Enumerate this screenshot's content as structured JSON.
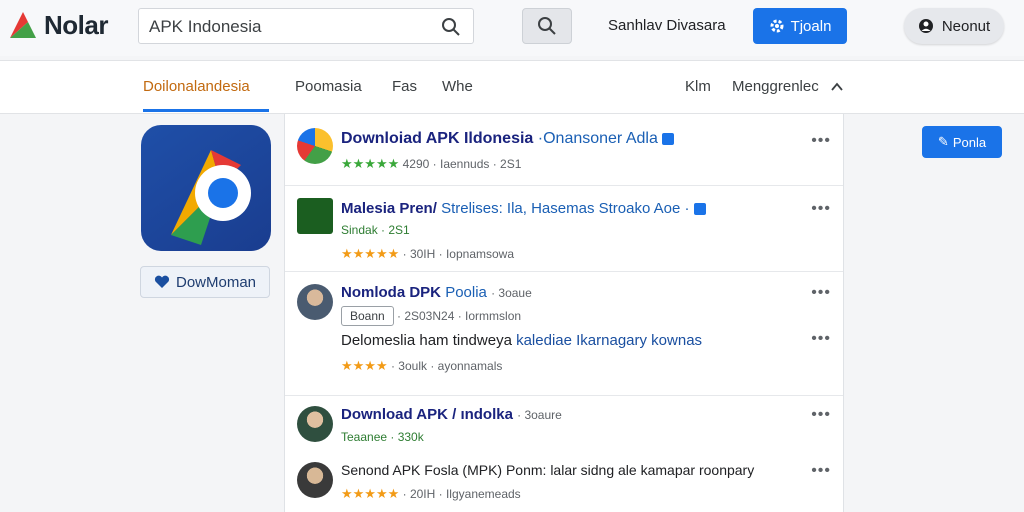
{
  "header": {
    "logo_text": "Nolar",
    "search_value": "APK Indonesia",
    "link_label": "Sanhlav Divasara",
    "join_label": "Tjoaln",
    "signin_label": "Neonut"
  },
  "tabs": {
    "items": [
      "Doilonalandesia",
      "Poomasia",
      "Fas",
      "Whe"
    ],
    "right_items": [
      "Klm",
      "Menggrenlec"
    ]
  },
  "app": {
    "download_label": "DowMoman"
  },
  "follow_label": "Ponla",
  "results": [
    {
      "title": "Downloiad APK Ildonesia",
      "subtitle": "·Onansoner Adla",
      "rating": "4290",
      "meta": "· Iaennuds · 2S1"
    },
    {
      "title": "Malesia Pren/",
      "subtitle": "Strelises: Ila, Hasemas Stroako Aoe ·",
      "line2": "Sindak · 2S1",
      "meta": "· 30IH · Iopnamsowa"
    },
    {
      "title": "Nomloda DPK",
      "subtitle": "Poolia",
      "extra": "· 3oaue",
      "badge": "Boann",
      "badge_meta": "· 2S03N24 · Iormmslon",
      "body_a": "Delomeslia ham tindweya",
      "body_b": "kalediae Ikarnagary kownas",
      "meta": "· 3oulk · ayonnamals"
    },
    {
      "title": "Download APK / ındolka",
      "extra": "· 3oaure",
      "line2": "Teaanee · 330k"
    },
    {
      "title": "Senond APK Fosla (MPK) Ponm: lalar sidng ale kamapar",
      "title_b": "roonpary",
      "meta": "· 20IH · Ilgyanemeads"
    }
  ],
  "colors": {
    "accent": "#1a73e8",
    "active_tab": "#c26a10",
    "title": "#1a237e"
  }
}
